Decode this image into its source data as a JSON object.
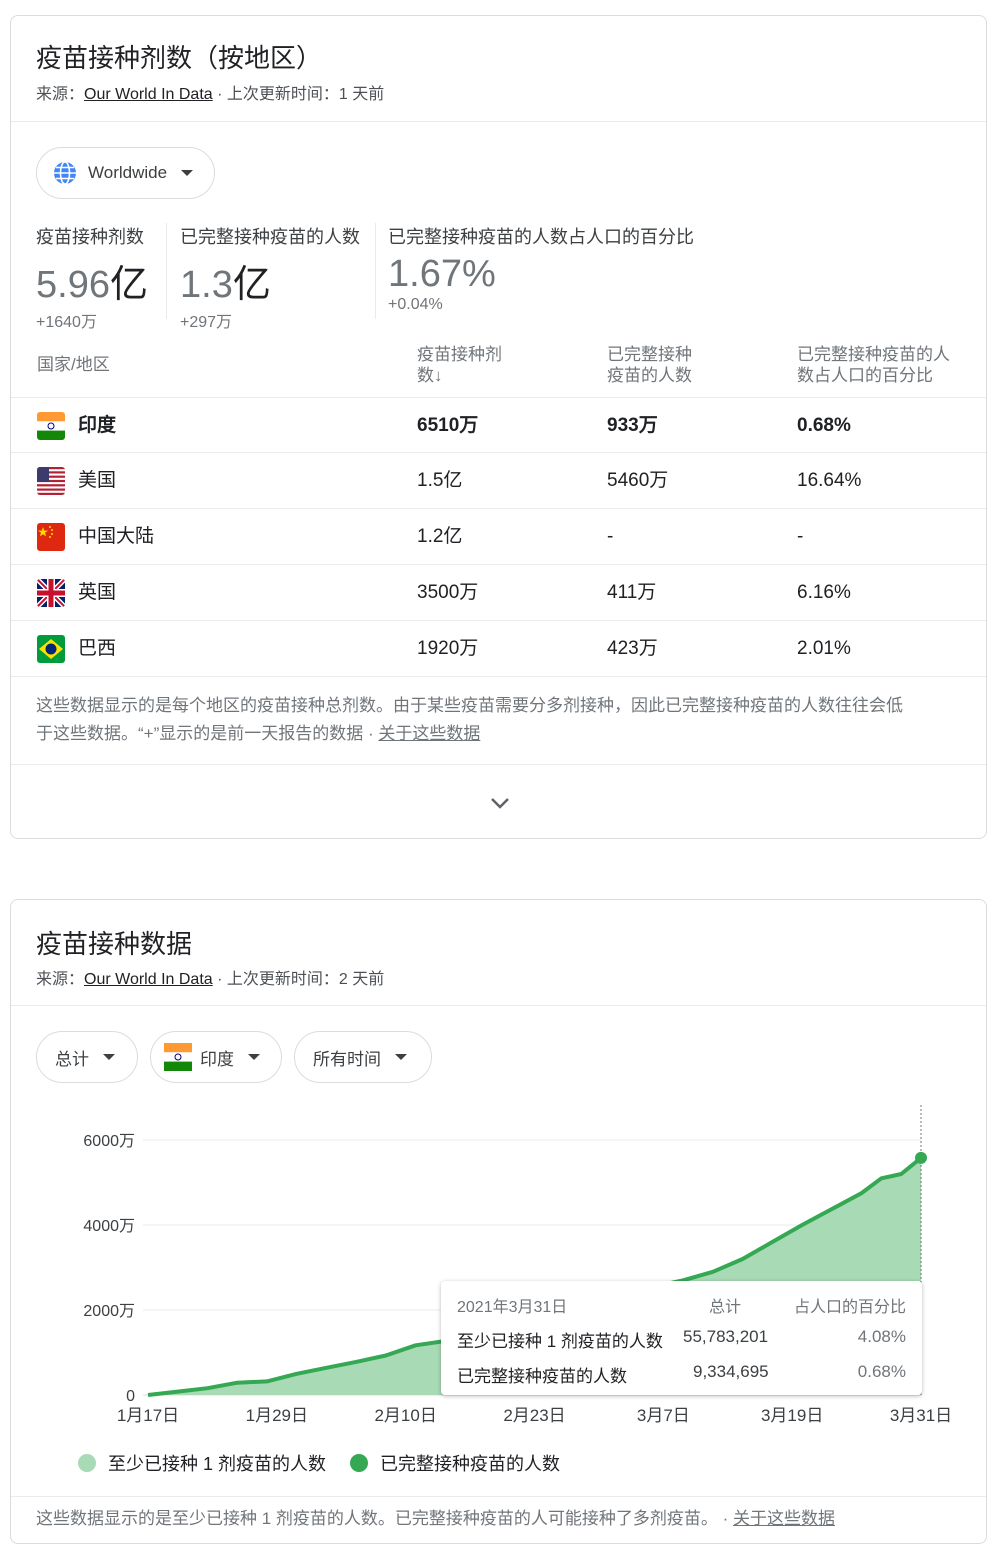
{
  "card1": {
    "title": "疫苗接种剂数（按地区）",
    "source_prefix": "来源：",
    "source_link": "Our World In Data",
    "source_suffix": " · 上次更新时间：1 天前",
    "region_chip": {
      "label": "Worldwide",
      "icon": "globe-icon"
    },
    "stats": [
      {
        "label": "疫苗接种剂数",
        "value": "5.96",
        "unit": "亿",
        "delta": "+1640万"
      },
      {
        "label": "已完整接种疫苗的人数",
        "value": "1.3",
        "unit": "亿",
        "delta": "+297万"
      },
      {
        "label": "已完整接种疫苗的人数占人口的百分比",
        "value": "1.67%",
        "unit": "",
        "delta": "+0.04%"
      }
    ],
    "table": {
      "headers": {
        "region": "国家/地区",
        "doses_line1": "疫苗接种剂",
        "doses_line2": "数↓",
        "full_line1": "已完整接种",
        "full_line2": "疫苗的人数",
        "pct_line1": "已完整接种疫苗的人",
        "pct_line2": "数占人口的百分比"
      },
      "rows": [
        {
          "flag": "india-flag",
          "region": "印度",
          "doses": "6510万",
          "full": "933万",
          "pct": "0.68%"
        },
        {
          "flag": "usa-flag",
          "region": "美国",
          "doses": "1.5亿",
          "full": "5460万",
          "pct": "16.64%"
        },
        {
          "flag": "china-flag",
          "region": "中国大陆",
          "doses": "1.2亿",
          "full": "-",
          "pct": "-"
        },
        {
          "flag": "uk-flag",
          "region": "英国",
          "doses": "3500万",
          "full": "411万",
          "pct": "6.16%"
        },
        {
          "flag": "brazil-flag",
          "region": "巴西",
          "doses": "1920万",
          "full": "423万",
          "pct": "2.01%"
        }
      ]
    },
    "note_line1": "这些数据显示的是每个地区的疫苗接种总剂数。由于某些疫苗需要分多剂接种，因此已完整接种疫苗的人数往往会低",
    "note_line2": "于这些数据。“+”显示的是前一天报告的数据 · ",
    "note_link": "关于这些数据",
    "expand_icon": "chevron-down-icon"
  },
  "card2": {
    "title": "疫苗接种数据",
    "source_prefix": "来源：",
    "source_link": "Our World In Data",
    "source_suffix": " · 上次更新时间：2 天前",
    "chips": {
      "metric": "总计",
      "country": "印度",
      "range": "所有时间"
    },
    "tooltip": {
      "date": "2021年3月31日",
      "col_total": "总计",
      "col_pct": "占人口的百分比",
      "rows": [
        {
          "label": "至少已接种 1 剂疫苗的人数",
          "total": "55,783,201",
          "pct": "4.08%"
        },
        {
          "label": "已完整接种疫苗的人数",
          "total": "9,334,695",
          "pct": "0.68%"
        }
      ]
    },
    "legend": [
      "至少已接种 1 剂疫苗的人数",
      "已完整接种疫苗的人数"
    ],
    "note": "这些数据显示的是至少已接种 1 剂疫苗的人数。已完整接种疫苗的人可能接种了多剂疫苗。",
    "note_sep": " · ",
    "note_link": "关于这些数据"
  },
  "chart_data": {
    "type": "area",
    "x_tick_labels": [
      "1月17日",
      "1月29日",
      "2月10日",
      "2月23日",
      "3月7日",
      "3月19日",
      "3月31日"
    ],
    "y_tick_labels": [
      "0",
      "2000万",
      "4000万",
      "6000万"
    ],
    "ylim": [
      0,
      60000000
    ],
    "xlim_days": [
      0,
      78
    ],
    "series": [
      {
        "name": "至少已接种 1 剂疫苗的人数",
        "color": "#a8dab5",
        "x_days": [
          0,
          3,
          6,
          9,
          12,
          15,
          18,
          21,
          24,
          27,
          30,
          33,
          36,
          39,
          42,
          45,
          48,
          51,
          54,
          57,
          60,
          63,
          66,
          68,
          70,
          72,
          74,
          76,
          78
        ],
        "values": [
          0,
          800000,
          1600000,
          2900000,
          3200000,
          5000000,
          6400000,
          7800000,
          9300000,
          11700000,
          12700000,
          14200000,
          15900000,
          18000000,
          20000000,
          22000000,
          24000000,
          25500000,
          27000000,
          29000000,
          32000000,
          36000000,
          40000000,
          42500000,
          45000000,
          47500000,
          51000000,
          52000000,
          55783201
        ]
      },
      {
        "name": "已完整接种疫苗的人数",
        "color": "#34a853",
        "values_note": "",
        "x_days": [
          0,
          78
        ],
        "values": [
          0,
          9334695
        ]
      }
    ],
    "grid": true,
    "legend_position": "bottom-left",
    "highlight_point": {
      "x_day": 78,
      "value": 55783201
    }
  }
}
